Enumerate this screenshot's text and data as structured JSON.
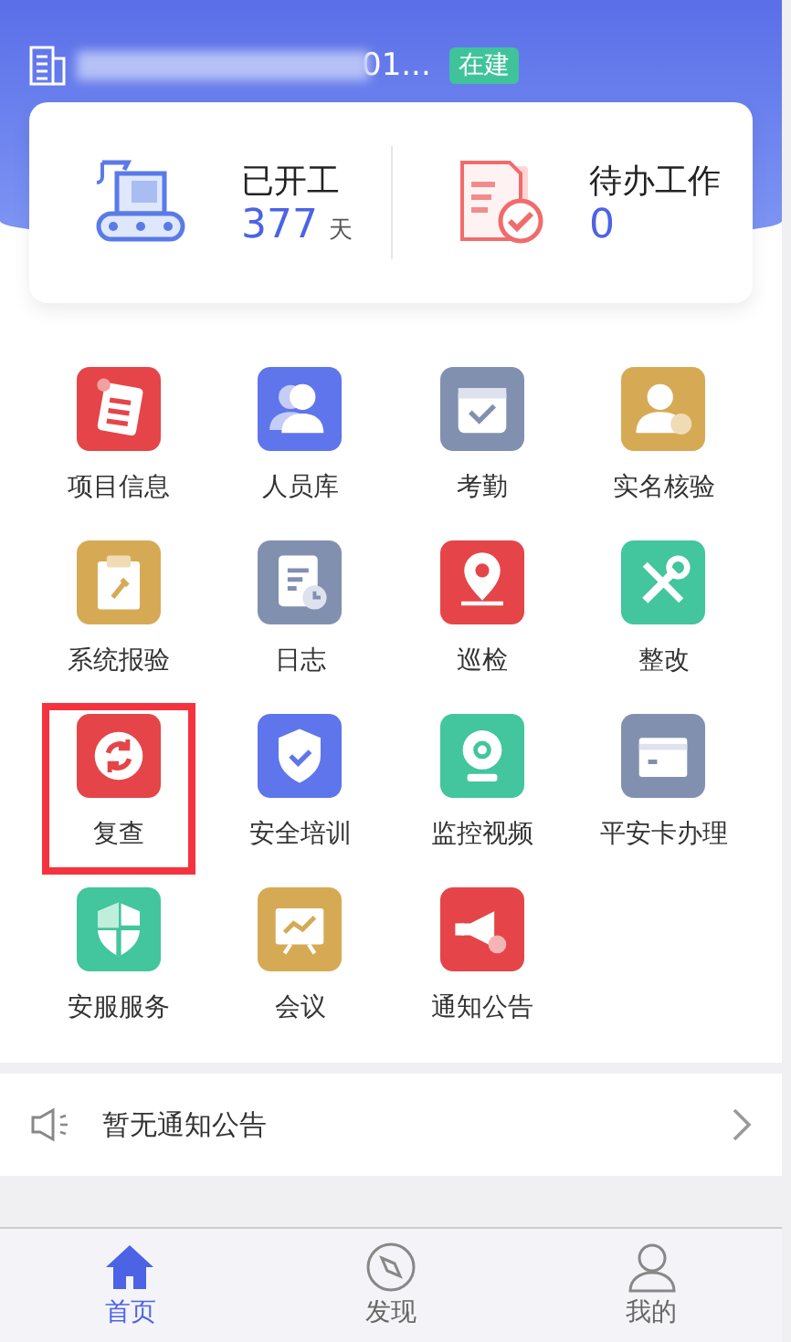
{
  "header": {
    "title": "01...",
    "status_tag": "在建"
  },
  "stats": [
    {
      "kind": "days",
      "label": "已开工",
      "value": "377",
      "unit": "天"
    },
    {
      "kind": "tasks",
      "label": "待办工作",
      "value": "0"
    }
  ],
  "apps": [
    {
      "label": "项目信息",
      "kind": "document",
      "color": "#e54548",
      "highlighted": false
    },
    {
      "label": "人员库",
      "kind": "people",
      "color": "#5f75ec",
      "highlighted": false
    },
    {
      "label": "考勤",
      "kind": "calendar",
      "color": "#8290b0",
      "highlighted": false
    },
    {
      "label": "实名核验",
      "kind": "person-check",
      "color": "#d6aa55",
      "highlighted": false
    },
    {
      "label": "系统报验",
      "kind": "clipboard",
      "color": "#d6aa55",
      "highlighted": false
    },
    {
      "label": "日志",
      "kind": "log",
      "color": "#8290b0",
      "highlighted": false
    },
    {
      "label": "巡检",
      "kind": "location",
      "color": "#e54548",
      "highlighted": false
    },
    {
      "label": "整改",
      "kind": "tools",
      "color": "#43c59e",
      "highlighted": false
    },
    {
      "label": "复查",
      "kind": "refresh",
      "color": "#e54548",
      "highlighted": true
    },
    {
      "label": "安全培训",
      "kind": "shield",
      "color": "#5f75ec",
      "highlighted": false
    },
    {
      "label": "监控视频",
      "kind": "camera",
      "color": "#43c59e",
      "highlighted": false
    },
    {
      "label": "平安卡办理",
      "kind": "card",
      "color": "#8290b0",
      "highlighted": false
    },
    {
      "label": "安服服务",
      "kind": "shield-half",
      "color": "#43c59e",
      "highlighted": false
    },
    {
      "label": "会议",
      "kind": "board",
      "color": "#d6aa55",
      "highlighted": false
    },
    {
      "label": "通知公告",
      "kind": "megaphone",
      "color": "#e54548",
      "highlighted": false
    }
  ],
  "notice": {
    "text": "暂无通知公告"
  },
  "tabs": [
    {
      "label": "首页",
      "kind": "home",
      "selected": true
    },
    {
      "label": "发现",
      "kind": "compass",
      "selected": false
    },
    {
      "label": "我的",
      "kind": "person",
      "selected": false
    }
  ]
}
